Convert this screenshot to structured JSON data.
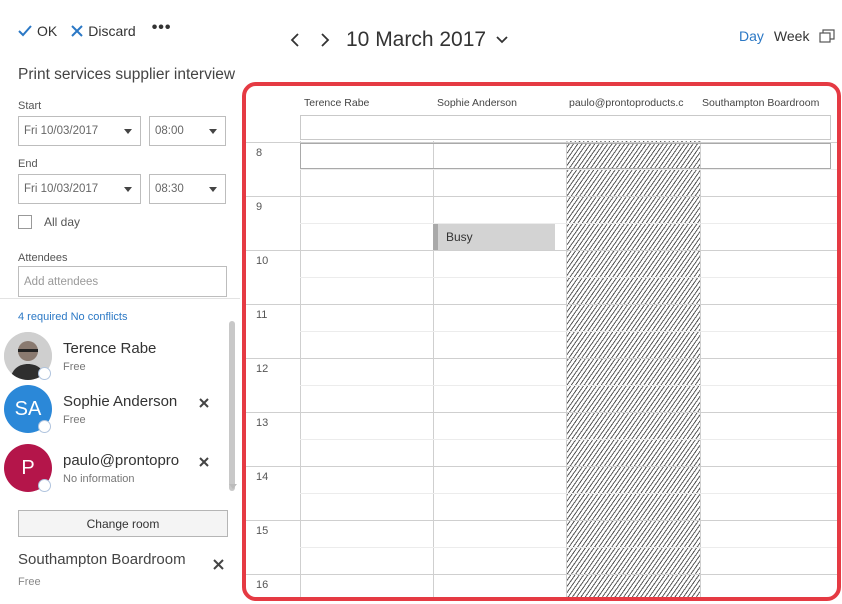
{
  "toolbar": {
    "ok_label": "OK",
    "discard_label": "Discard",
    "more_label": "•••"
  },
  "date_nav": {
    "date_title": "10 March 2017"
  },
  "view_switch": {
    "day_label": "Day",
    "week_label": "Week",
    "active": "Day"
  },
  "form": {
    "subject": "Print services supplier interview",
    "start_label": "Start",
    "start_date": "Fri 10/03/2017",
    "start_time": "08:00",
    "end_label": "End",
    "end_date": "Fri 10/03/2017",
    "end_time": "08:30",
    "all_day_label": "All day",
    "attendees_label": "Attendees",
    "attendees_placeholder": "Add attendees",
    "required_summary": "4 required No conflicts"
  },
  "attendees": [
    {
      "name": "Terence Rabe",
      "status": "Free",
      "initials": ""
    },
    {
      "name": "Sophie Anderson",
      "status": "Free",
      "initials": "SA"
    },
    {
      "name": "paulo@prontopro",
      "status": "No information",
      "initials": "P"
    }
  ],
  "room": {
    "change_room_label": "Change room",
    "name": "Southampton Boardroom",
    "status": "Free"
  },
  "schedule": {
    "columns": [
      "Terence Rabe",
      "Sophie Anderson",
      "paulo@prontoproducts.c",
      "Southampton Boardroom"
    ],
    "hours": [
      "8",
      "9",
      "10",
      "11",
      "12",
      "13",
      "14",
      "15",
      "16"
    ],
    "busy_label": "Busy",
    "colors": {
      "highlight_border": "#e53a43",
      "accent": "#2b78c5",
      "busy_fill": "#d3d3d3"
    }
  }
}
